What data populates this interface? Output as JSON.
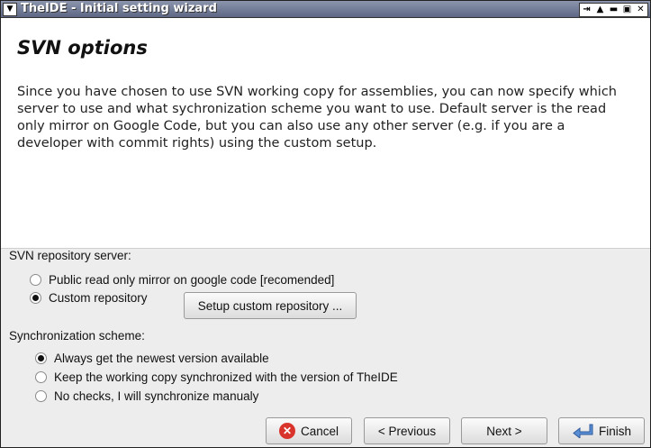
{
  "window": {
    "title": "TheIDE - Initial setting wizard",
    "menu_icon": "chevron-down-icon",
    "controls": [
      "pin-icon",
      "maximize-up-icon",
      "minimize-icon",
      "restore-icon",
      "close-icon"
    ]
  },
  "header": {
    "heading": "SVN options",
    "description": "Since you have chosen to use SVN working copy for assemblies, you can now specify which server to use and what sychronization scheme you want to use. Default server is the read only mirror on Google Code, but you can also use any other server (e.g. if you are a developer with commit rights) using the custom setup."
  },
  "server": {
    "label": "SVN repository server:",
    "options": [
      {
        "label": "Public read only mirror on google code [recomended]",
        "selected": false
      },
      {
        "label": "Custom repository",
        "selected": true
      }
    ],
    "setup_button": "Setup custom repository ..."
  },
  "sync": {
    "label": "Synchronization scheme:",
    "options": [
      {
        "label": "Always get the newest version available",
        "selected": true
      },
      {
        "label": "Keep the working copy synchronized with the version of TheIDE",
        "selected": false
      },
      {
        "label": "No checks, I will synchronize manualy",
        "selected": false
      }
    ]
  },
  "buttons": {
    "cancel": "Cancel",
    "previous": "< Previous",
    "next": "Next >",
    "finish": "Finish"
  },
  "colors": {
    "titlebar": "#5d6784",
    "cancel_icon": "#d9342b",
    "finish_icon": "#5a8fd6"
  }
}
